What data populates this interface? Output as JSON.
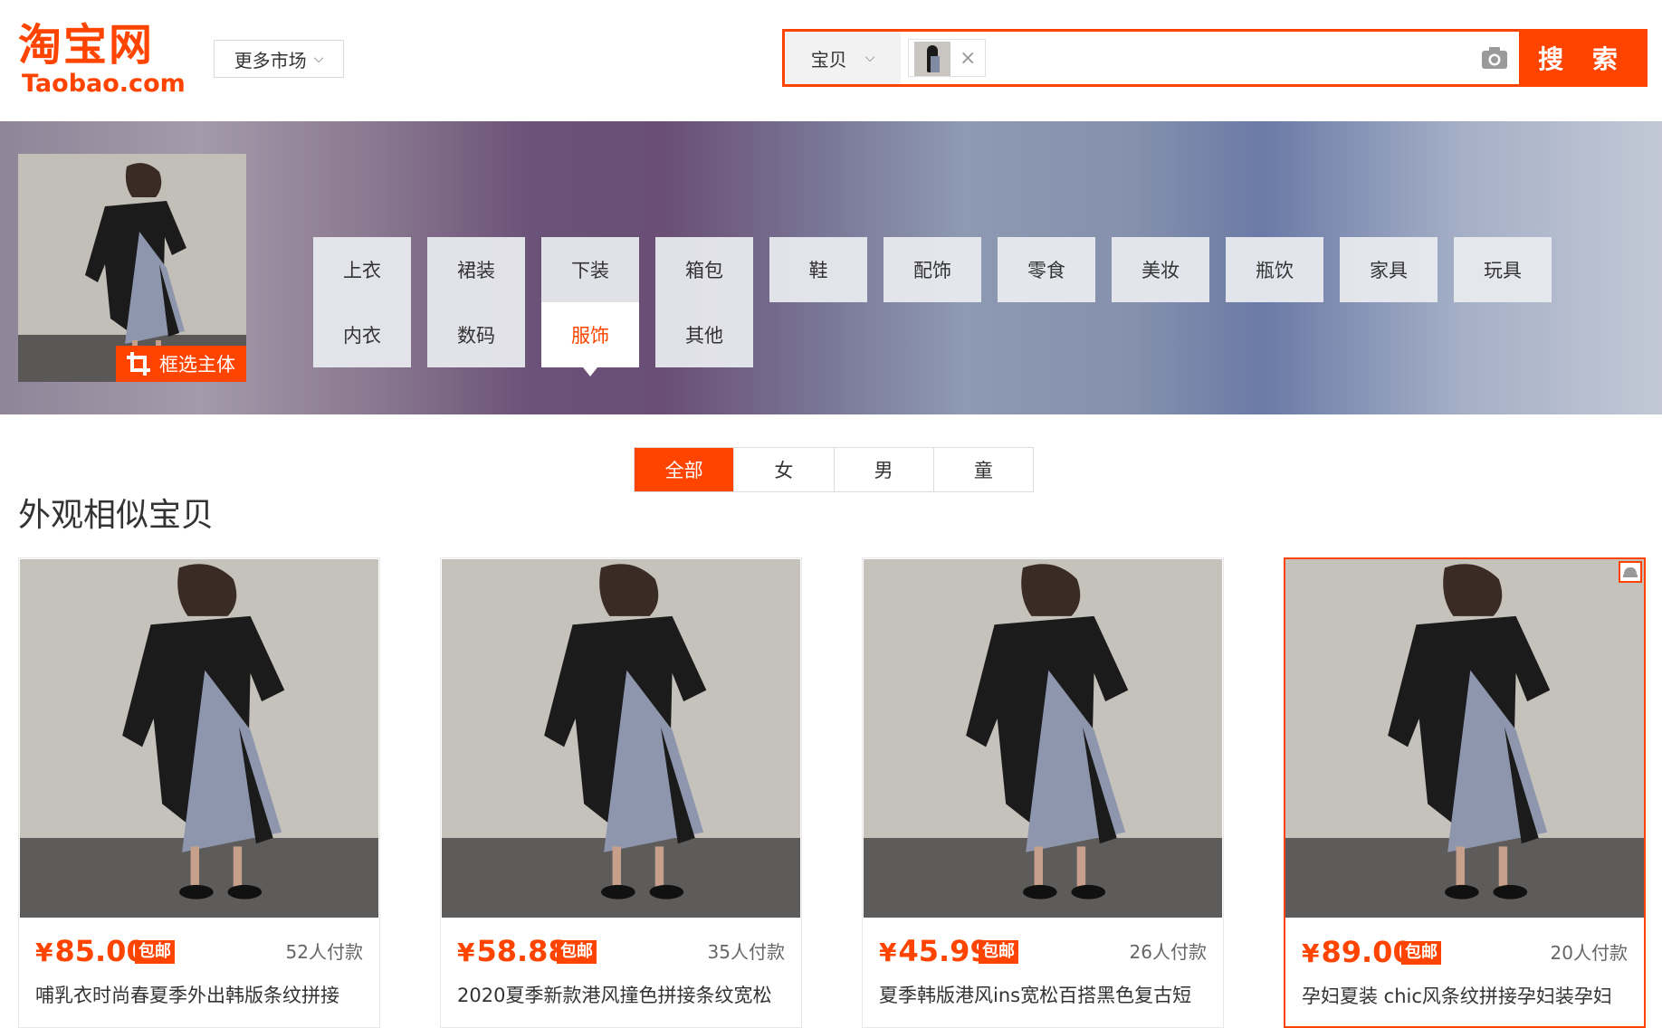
{
  "header": {
    "logo_cn": "淘宝网",
    "logo_en": "Taobao.com",
    "market_label": "更多市场",
    "search_type": "宝贝",
    "search_button": "搜 索",
    "brand_color": "#ff4400"
  },
  "banner": {
    "frame_button": "框选主体",
    "categories": [
      {
        "label": "上衣"
      },
      {
        "label": "裙装"
      },
      {
        "label": "下装"
      },
      {
        "label": "箱包"
      },
      {
        "label": "鞋"
      },
      {
        "label": "配饰"
      },
      {
        "label": "零食"
      },
      {
        "label": "美妆"
      },
      {
        "label": "瓶饮"
      },
      {
        "label": "家具"
      },
      {
        "label": "玩具"
      },
      {
        "label": "内衣"
      },
      {
        "label": "数码"
      },
      {
        "label": "服饰",
        "active": true
      },
      {
        "label": "其他"
      }
    ]
  },
  "tabs": [
    "全部",
    "女",
    "男",
    "童"
  ],
  "active_tab": "全部",
  "section_title": "外观相似宝贝",
  "products": [
    {
      "price": "85.00",
      "yen": "¥",
      "free_shipping": "包邮",
      "sales": "52人付款",
      "title": "哺乳衣时尚春夏季外出韩版条纹拼接"
    },
    {
      "price": "58.88",
      "yen": "¥",
      "free_shipping": "包邮",
      "sales": "35人付款",
      "title": "2020夏季新款港风撞色拼接条纹宽松"
    },
    {
      "price": "45.99",
      "yen": "¥",
      "free_shipping": "包邮",
      "sales": "26人付款",
      "title": "夏季韩版港风ins宽松百搭黑色复古短"
    },
    {
      "price": "89.00",
      "yen": "¥",
      "free_shipping": "包邮",
      "sales": "20人付款",
      "title": "孕妇夏装 chic风条纹拼接孕妇装孕妇"
    }
  ]
}
